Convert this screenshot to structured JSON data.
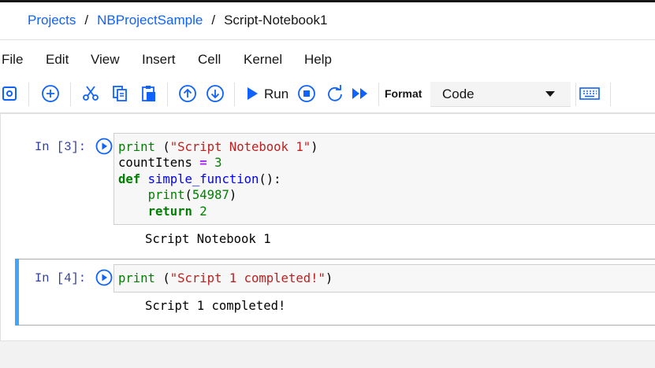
{
  "breadcrumb": {
    "items": [
      {
        "label": "Projects"
      },
      {
        "label": "NBProjectSample"
      }
    ],
    "separator": "/",
    "current": "Script-Notebook1"
  },
  "menu": {
    "items": [
      "File",
      "Edit",
      "View",
      "Insert",
      "Cell",
      "Kernel",
      "Help"
    ]
  },
  "toolbar": {
    "icons": [
      "save-icon",
      "add-cell-icon",
      "cut-icon",
      "copy-icon",
      "paste-icon",
      "move-up-icon",
      "move-down-icon",
      "run-icon",
      "stop-icon",
      "restart-icon",
      "run-all-icon",
      "keyboard-icon"
    ],
    "run_label": "Run",
    "format_label": "Format",
    "format_value": "Code",
    "accent_color": "#0f62fe"
  },
  "cells": [
    {
      "prompt": "In [3]:",
      "code_lines": [
        [
          {
            "t": "print",
            "c": "bi"
          },
          {
            "t": " (",
            "c": ""
          },
          {
            "t": "\"Script Notebook 1\"",
            "c": "str"
          },
          {
            "t": ")",
            "c": ""
          }
        ],
        [
          {
            "t": "countItens ",
            "c": ""
          },
          {
            "t": "=",
            "c": "op"
          },
          {
            "t": " ",
            "c": ""
          },
          {
            "t": "3",
            "c": "num"
          }
        ],
        [
          {
            "t": "def",
            "c": "kw"
          },
          {
            "t": " ",
            "c": ""
          },
          {
            "t": "simple_function",
            "c": "fn"
          },
          {
            "t": "():",
            "c": ""
          }
        ],
        [
          {
            "t": "    ",
            "c": ""
          },
          {
            "t": "print",
            "c": "bi"
          },
          {
            "t": "(",
            "c": ""
          },
          {
            "t": "54987",
            "c": "num"
          },
          {
            "t": ")",
            "c": ""
          }
        ],
        [
          {
            "t": "    ",
            "c": ""
          },
          {
            "t": "return",
            "c": "kw"
          },
          {
            "t": " ",
            "c": ""
          },
          {
            "t": "2",
            "c": "num"
          }
        ]
      ],
      "output": "Script Notebook 1"
    },
    {
      "prompt": "In [4]:",
      "code_lines": [
        [
          {
            "t": "print",
            "c": "bi"
          },
          {
            "t": " (",
            "c": ""
          },
          {
            "t": "\"Script 1 completed!\"",
            "c": "str"
          },
          {
            "t": ")",
            "c": ""
          }
        ]
      ],
      "output": "Script 1 completed!",
      "selected": true,
      "selected_color": "#42a5f5"
    }
  ]
}
